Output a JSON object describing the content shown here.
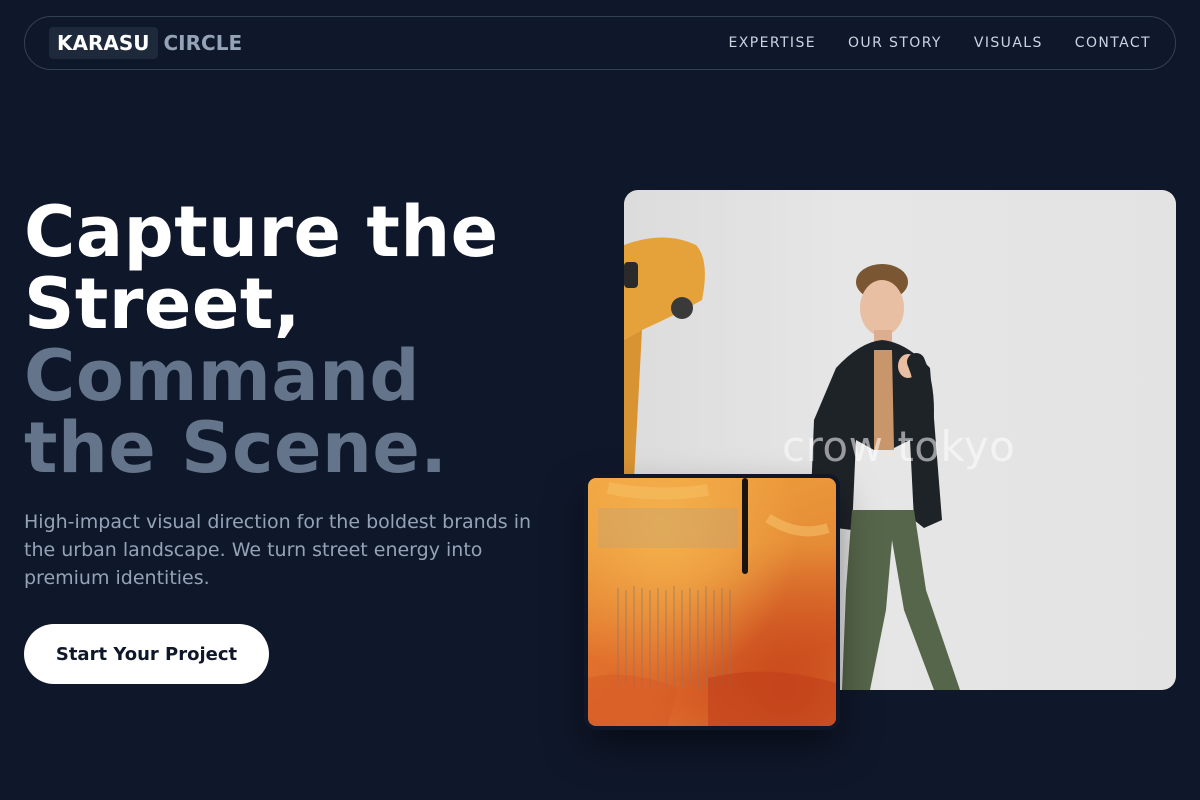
{
  "brand": {
    "part1": "KARASU",
    "part2": "CIRCLE"
  },
  "nav": {
    "links": [
      "EXPERTISE",
      "OUR STORY",
      "VISUALS",
      "CONTACT"
    ]
  },
  "hero": {
    "title_line1": "Capture the",
    "title_line2": "Street,",
    "title_line3": "Command",
    "title_line4": "the Scene.",
    "subtitle": "High-impact visual direction for the boldest brands in the urban landscape. We turn street energy into premium identities.",
    "cta_label": "Start Your Project"
  },
  "media": {
    "photo_watermark": "crow tokyo"
  },
  "colors": {
    "background": "#0f172a",
    "accent_muted": "#64748b",
    "cta_bg": "#ffffff"
  }
}
